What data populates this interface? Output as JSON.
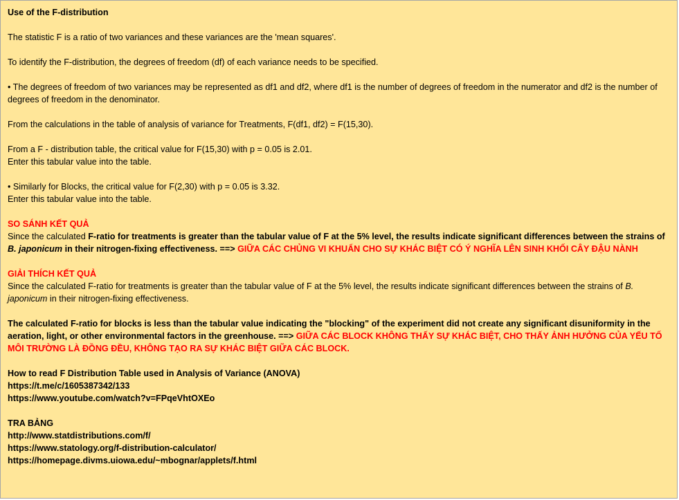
{
  "title": "Use of the F-distribution",
  "p1": "The statistic F is a ratio of two variances and these variances are the 'mean squares'.",
  "p2": "To identify the F-distribution, the degrees of freedom (df) of each variance needs to be specified.",
  "p3": "• The degrees of freedom of two variances may be represented as df1 and df2, where df1 is the number of degrees of freedom in the numerator and df2 is the number of degrees of freedom in the denominator.",
  "p4": "From the calculations in the table of analysis of variance for Treatments, F(df1, df2) = F(15,30).",
  "p5_line1": "From a F - distribution table, the critical value for F(15,30) with p = 0.05 is 2.01.",
  "p5_line2": "Enter this tabular value into the table.",
  "p6_line1": "• Similarly for Blocks, the critical value for F(2,30) with p = 0.05 is 3.32.",
  "p6_line2": "Enter this tabular value into the table.",
  "compare": {
    "heading": "SO SÁNH KẾT QUẢ",
    "t1": "Since the calculated ",
    "t2": "F-ratio for treatments is greater than the tabular value of F at the 5% level, the results indicate significant differences between the strains of ",
    "t3": "B. japonicum",
    "t4": " in their nitrogen-fixing effectiveness. ==> ",
    "t5": "GIỮA CÁC CHỦNG VI KHUẨN CHO SỰ KHÁC BIỆT CÓ Ý NGHĨA LÊN SINH KHỐI CÂY ĐẬU NÀNH"
  },
  "explain": {
    "heading": "GIẢI THÍCH KẾT QUẢ",
    "t1": "Since the calculated F-ratio for treatments is greater than the tabular value of F at the 5% level, the results indicate significant differences between the strains of ",
    "t2": "B. japonicum",
    "t3": " in their nitrogen-fixing effectiveness."
  },
  "blocks": {
    "t1": "The calculated F-ratio for blocks is less than the tabular value indicating the \"blocking\" of the experiment did not create any significant disuniformity in the aeration, light, or other environmental factors in the greenhouse. ==> ",
    "t2": "GIỮA CÁC BLOCK KHÔNG THẤY SỰ KHÁC BIỆT, CHO THẤY ẢNH HƯỞNG CỦA YẾU TỐ MÔI TRƯỜNG LÀ ĐỒNG ĐỀU, KHÔNG TẠO RA SỰ KHÁC BIỆT GIỮA CÁC BLOCK."
  },
  "howto": {
    "heading": "How to read F Distribution Table used in Analysis of Variance (ANOVA)",
    "links": [
      "https://t.me/c/1605387342/133",
      "https://www.youtube.com/watch?v=FPqeVhtOXEo"
    ]
  },
  "tra_bang": {
    "heading": "TRA BẢNG",
    "links": [
      "http://www.statdistributions.com/f/",
      "https://www.statology.org/f-distribution-calculator/",
      "https://homepage.divms.uiowa.edu/~mbognar/applets/f.html"
    ]
  },
  "colors": {
    "background": "#ffe699",
    "accent_red": "#ff0000",
    "border": "#a6a6a6"
  }
}
